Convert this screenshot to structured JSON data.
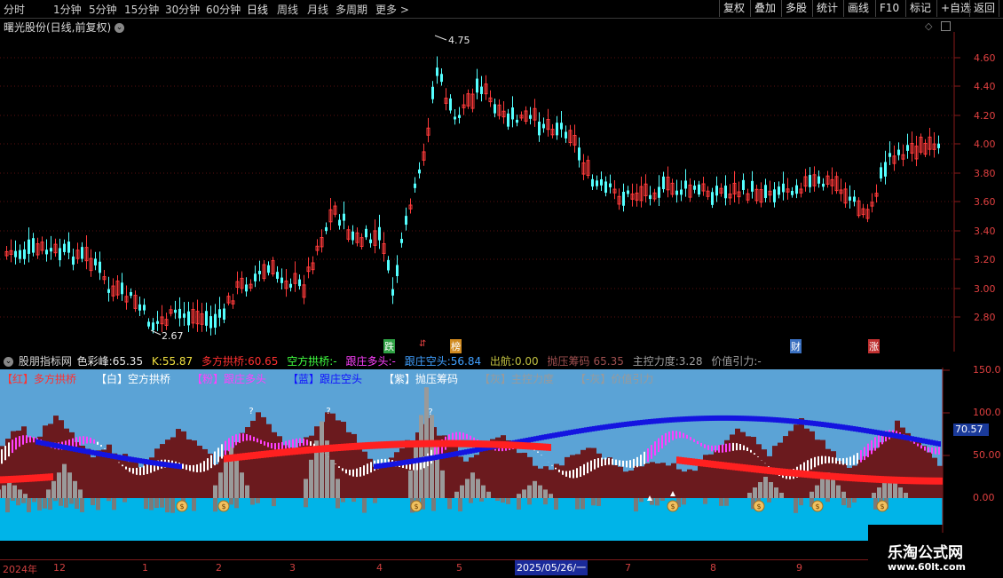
{
  "toolbar": {
    "periods": [
      "分时",
      "1分钟",
      "5分钟",
      "15分钟",
      "30分钟",
      "60分钟",
      "日线",
      "周线",
      "月线",
      "多周期",
      "更多 >"
    ],
    "buttons": [
      "复权",
      "叠加",
      "多股",
      "统计",
      "画线",
      "F10",
      "标记",
      "+自选",
      "返回"
    ]
  },
  "main_chart": {
    "title": "曙光股份(日线,前复权)",
    "price_axis": [
      "4.60",
      "4.40",
      "4.20",
      "4.00",
      "3.80",
      "3.60",
      "3.40",
      "3.20",
      "3.00",
      "2.80"
    ],
    "high_marker": "4.75",
    "low_marker": "2.67",
    "event_tags": [
      {
        "text": "跌",
        "color": "#2ea043"
      },
      {
        "text": "⇵",
        "color": "#e04040"
      },
      {
        "text": "榜",
        "color": "#d08a20"
      },
      {
        "text": "财",
        "color": "#4a90d9"
      },
      {
        "text": "涨",
        "color": "#e04040"
      }
    ]
  },
  "indicator": {
    "name": "股朋指标网",
    "values": [
      {
        "label": "色彩峰:",
        "value": "65.35",
        "color": "#e8e8e8"
      },
      {
        "label": "K:",
        "value": "55.87",
        "color": "#f0e040"
      },
      {
        "label": "多方拱桥:",
        "value": "60.65",
        "color": "#ff3030"
      },
      {
        "label": "空方拱桥:",
        "value": "-",
        "color": "#40ff40"
      },
      {
        "label": "跟庄多头:",
        "value": "-",
        "color": "#ff40ff"
      },
      {
        "label": "跟庄空头:",
        "value": "56.84",
        "color": "#40a0ff"
      },
      {
        "label": "出航:",
        "value": "0.00",
        "color": "#c0c040"
      },
      {
        "label": "抛压筹码",
        "value": "65.35",
        "color": "#a05050"
      },
      {
        "label": "主控力度:",
        "value": "3.28",
        "color": "#a0a0a0"
      },
      {
        "label": "价值引力:",
        "value": "-",
        "color": "#a0a0a0"
      }
    ],
    "legend": [
      {
        "text": "【红】多方拱桥",
        "color": "#ff3030"
      },
      {
        "text": "【白】空方拱桥",
        "color": "#ffffff"
      },
      {
        "text": "【粉】跟庄多头",
        "color": "#ff40ff"
      },
      {
        "text": "【蓝】跟庄空头",
        "color": "#1010ff"
      },
      {
        "text": "【紫】抛压筹码",
        "color": "#ffffff"
      },
      {
        "text": "【灰】主控力度",
        "color": "#9a9a9a"
      },
      {
        "text": "【-灰】价值引力",
        "color": "#9a9a9a"
      }
    ],
    "axis": [
      "150.0",
      "100.0",
      "50.00",
      "0.00"
    ],
    "current_value": "70.57"
  },
  "date_axis": [
    "2024年",
    "12",
    "1",
    "2",
    "3",
    "4",
    "5",
    "2025/05/26/一",
    "7",
    "8",
    "9"
  ],
  "watermark": {
    "title": "乐淘公式网",
    "url": "www.60lt.com"
  },
  "colors": {
    "up": "#ff3a3a",
    "down": "#54ffff",
    "bg": "#000000",
    "panel": "#5ba3d6",
    "grid": "#6a1010"
  }
}
